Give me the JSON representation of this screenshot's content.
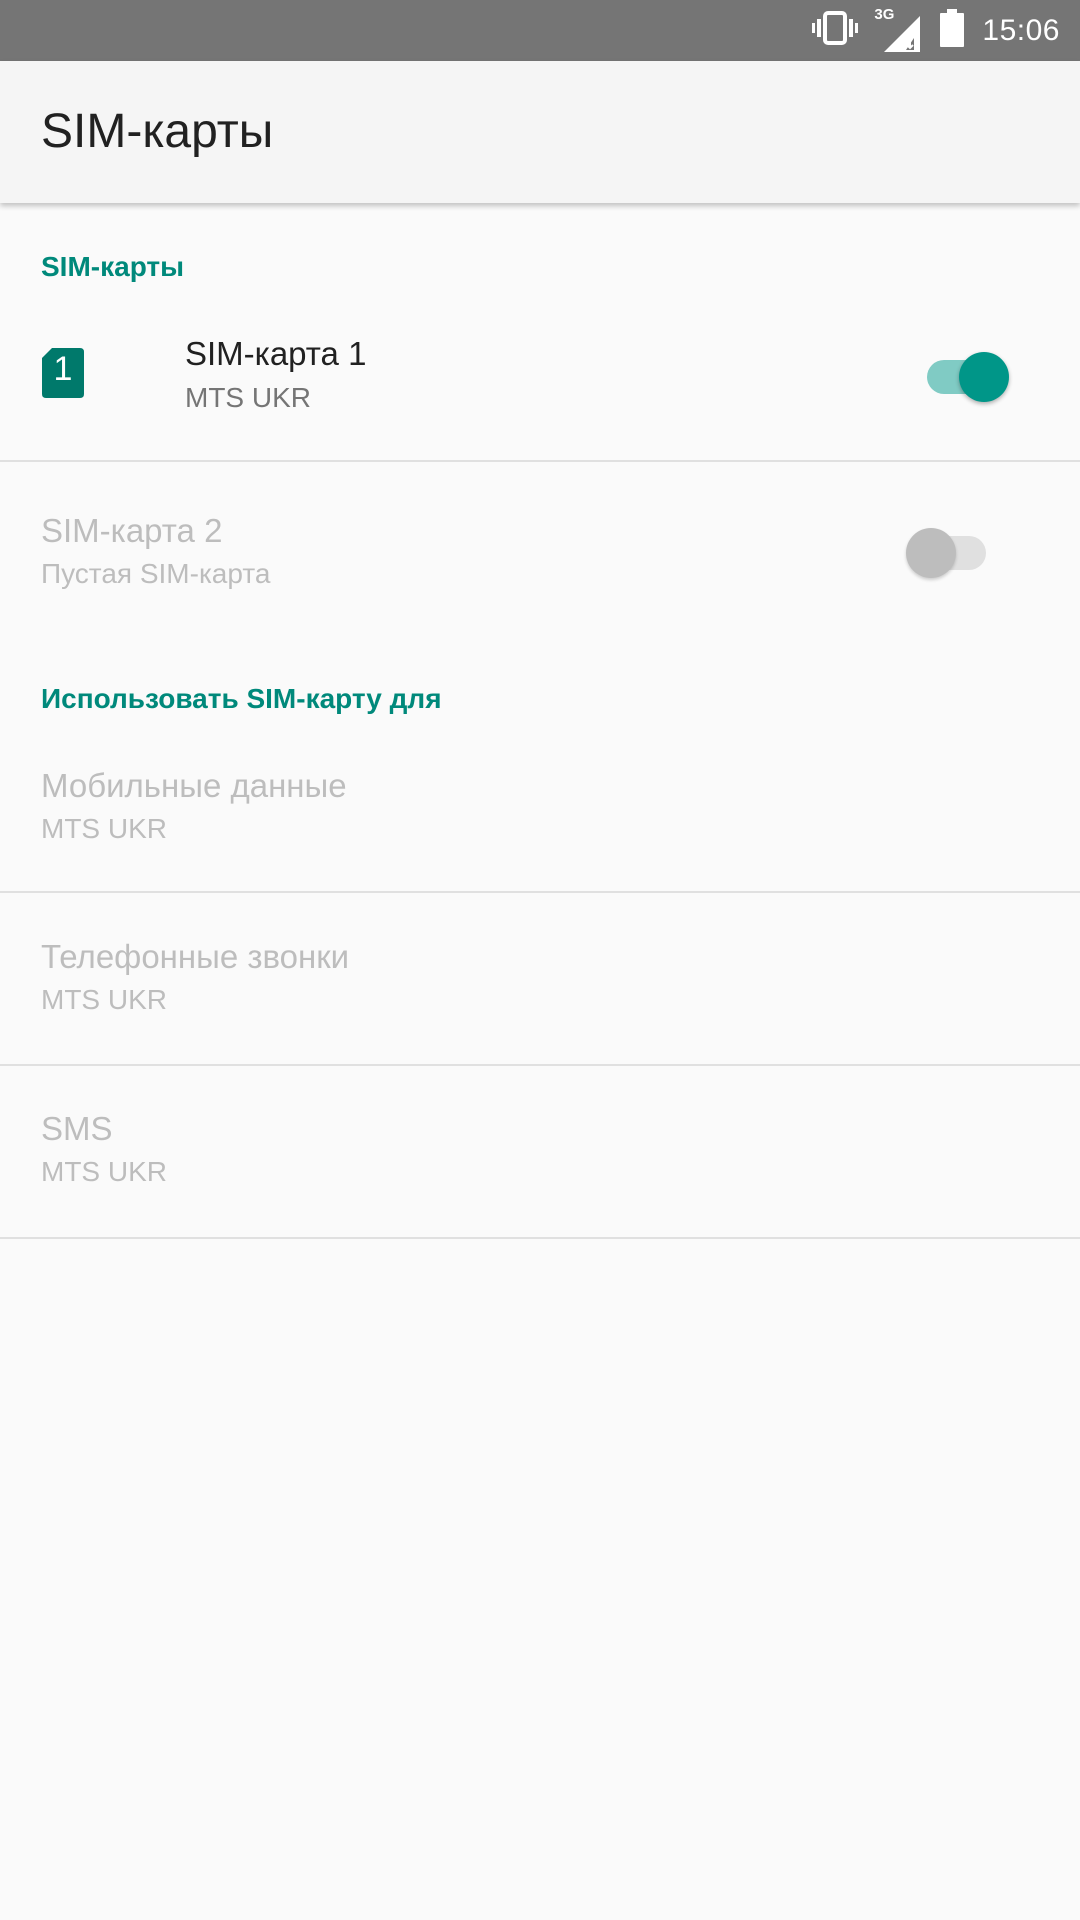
{
  "status_bar": {
    "network": "3G",
    "time": "15:06",
    "icons": [
      "vibrate-icon",
      "signal-icon",
      "battery-icon"
    ]
  },
  "app_bar": {
    "title": "SIM-карты"
  },
  "sim_section": {
    "header": "SIM-карты",
    "sim1": {
      "badge": "1",
      "title": "SIM-карта 1",
      "subtitle": "MTS UKR",
      "enabled": true
    },
    "sim2": {
      "title": "SIM-карта 2",
      "subtitle": "Пустая SIM-карта",
      "enabled": false
    }
  },
  "use_section": {
    "header": "Использовать SIM-карту для",
    "items": [
      {
        "title": "Мобильные данные",
        "subtitle": "MTS UKR"
      },
      {
        "title": "Телефонные звонки",
        "subtitle": "MTS UKR"
      },
      {
        "title": "SMS",
        "subtitle": "MTS UKR"
      }
    ]
  },
  "colors": {
    "accent": "#009688",
    "accent_dark": "#00796b",
    "accent_track": "#80cbc4",
    "disabled_text": "#bdbdbd",
    "primary_text": "#212121",
    "secondary_text": "#757575",
    "status_bar": "#757575"
  }
}
